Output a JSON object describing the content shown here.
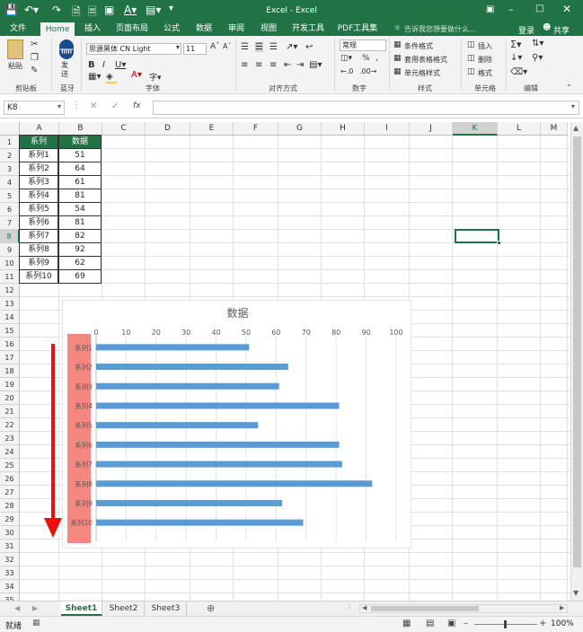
{
  "window": {
    "title": "Excel - Excel",
    "login": "登录",
    "share": "共享",
    "tell_me": "告诉我您想要做什么..."
  },
  "tabs": [
    "文件",
    "Home",
    "插入",
    "页面布局",
    "公式",
    "数据",
    "审阅",
    "视图",
    "开发工具",
    "PDF工具集"
  ],
  "ribbon": {
    "paste": "粘贴",
    "send": "发送",
    "font_name": "思源黑体 CN Light",
    "font_size": "11",
    "number_format": "常规",
    "cond_format": "条件格式",
    "table_format": "套用表格格式",
    "cell_style": "单元格样式",
    "insert": "插入",
    "delete": "删除",
    "format": "格式",
    "groups": [
      "剪贴板",
      "蓝牙",
      "字体",
      "对齐方式",
      "数字",
      "样式",
      "单元格",
      "编辑"
    ]
  },
  "formula_bar": {
    "name_box": "K8",
    "formula": "",
    "fx": "fx"
  },
  "columns": [
    "A",
    "B",
    "C",
    "D",
    "E",
    "F",
    "G",
    "H",
    "I",
    "J",
    "K",
    "L",
    "M"
  ],
  "rows": [
    "1",
    "2",
    "3",
    "4",
    "5",
    "6",
    "7",
    "8",
    "9",
    "10",
    "11",
    "12",
    "13",
    "14",
    "15",
    "16",
    "17",
    "18",
    "19",
    "20",
    "21",
    "22",
    "23",
    "24",
    "25",
    "26",
    "27",
    "28",
    "29",
    "30",
    "31",
    "32",
    "33",
    "34",
    "35"
  ],
  "table": {
    "headers": [
      "系列",
      "数据"
    ],
    "rows": [
      [
        "系列1",
        "51"
      ],
      [
        "系列2",
        "64"
      ],
      [
        "系列3",
        "61"
      ],
      [
        "系列4",
        "81"
      ],
      [
        "系列5",
        "54"
      ],
      [
        "系列6",
        "81"
      ],
      [
        "系列7",
        "82"
      ],
      [
        "系列8",
        "92"
      ],
      [
        "系列9",
        "62"
      ],
      [
        "系列10",
        "69"
      ]
    ]
  },
  "chart_data": {
    "type": "bar",
    "orientation": "horizontal",
    "title": "数据",
    "categories": [
      "系列1",
      "系列2",
      "系列3",
      "系列4",
      "系列5",
      "系列6",
      "系列7",
      "系列8",
      "系列9",
      "系列10"
    ],
    "values": [
      51,
      64,
      61,
      81,
      54,
      81,
      82,
      92,
      62,
      69
    ],
    "xlim": [
      0,
      100
    ],
    "ticks": [
      "0",
      "10",
      "20",
      "30",
      "40",
      "50",
      "60",
      "70",
      "80",
      "90",
      "100"
    ],
    "axis_position": "top",
    "grid": true,
    "bar_color": "#5b9bd5",
    "category_highlight_color": "#f4877f",
    "annotation_arrow_color": "#e8110e"
  },
  "sheets": [
    "Sheet1",
    "Sheet2",
    "Sheet3"
  ],
  "status": {
    "ready": "就绪",
    "zoom": "100%"
  },
  "colors": {
    "brand": "#217346",
    "header_fill": "#217346",
    "selection": "#217346"
  }
}
